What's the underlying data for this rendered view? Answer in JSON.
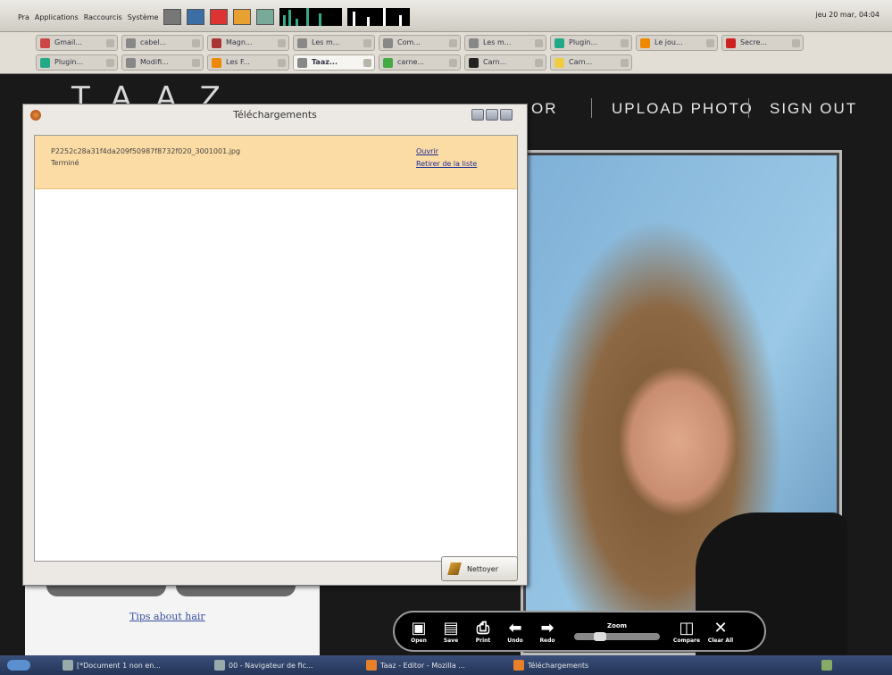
{
  "top_panel": {
    "menus": [
      "Pra",
      "Applications",
      "Raccourcis",
      "Système"
    ],
    "clock": "jeu 20 mar, 04:04"
  },
  "browser_tabs": {
    "row1": [
      {
        "label": "Gmail...",
        "color": "#c44"
      },
      {
        "label": "cabel...",
        "color": "#888"
      },
      {
        "label": "Magn...",
        "color": "#a33"
      },
      {
        "label": "Les m...",
        "color": "#888"
      },
      {
        "label": "Com...",
        "color": "#888"
      },
      {
        "label": "Les m...",
        "color": "#888"
      },
      {
        "label": "Plugin...",
        "color": "#2a8"
      },
      {
        "label": "Le jou...",
        "color": "#e80"
      },
      {
        "label": "Secre...",
        "color": "#c22"
      }
    ],
    "row2": [
      {
        "label": "Plugin...",
        "color": "#2a8"
      },
      {
        "label": "Modifi...",
        "color": "#888"
      },
      {
        "label": "Les F...",
        "color": "#e80"
      },
      {
        "label": "Taaz...",
        "color": "#888",
        "active": true
      },
      {
        "label": "carne...",
        "color": "#4a4"
      },
      {
        "label": "Carn...",
        "color": "#222"
      },
      {
        "label": "Carn...",
        "color": "#ec4"
      }
    ]
  },
  "site": {
    "logo": "TAAZ",
    "nav": [
      "OR",
      "UPLOAD PHOTO",
      "SIGN OUT"
    ],
    "tips_link": "Tips about hair"
  },
  "toolbar": {
    "tools_left": [
      {
        "label": "Open",
        "icon": "open-icon",
        "glyph": "▣"
      },
      {
        "label": "Save",
        "icon": "save-icon",
        "glyph": "▤"
      },
      {
        "label": "Print",
        "icon": "print-icon",
        "glyph": "⎙"
      },
      {
        "label": "Undo",
        "icon": "undo-arrow-icon",
        "glyph": "⬅"
      },
      {
        "label": "Redo",
        "icon": "redo-arrow-icon",
        "glyph": "➡"
      }
    ],
    "zoom_label": "Zoom",
    "tools_right": [
      {
        "label": "Compare",
        "icon": "compare-icon",
        "glyph": "◫"
      },
      {
        "label": "Clear All",
        "icon": "clear-all-icon",
        "glyph": "✕"
      }
    ]
  },
  "download_dialog": {
    "title": "Téléchargements",
    "item": {
      "filename": "P2252c28a31f4da209f50987f8732f020_3001001.jpg",
      "status": "Terminé",
      "open_link": "Ouvrir",
      "remove_link": "Retirer de la liste"
    },
    "clean_button": "Nettoyer"
  },
  "taskbar": {
    "items": [
      "[*Document 1 non en...",
      "00 - Navigateur de fic...",
      "Taaz - Editor - Mozilla ...",
      "Téléchargements"
    ]
  }
}
